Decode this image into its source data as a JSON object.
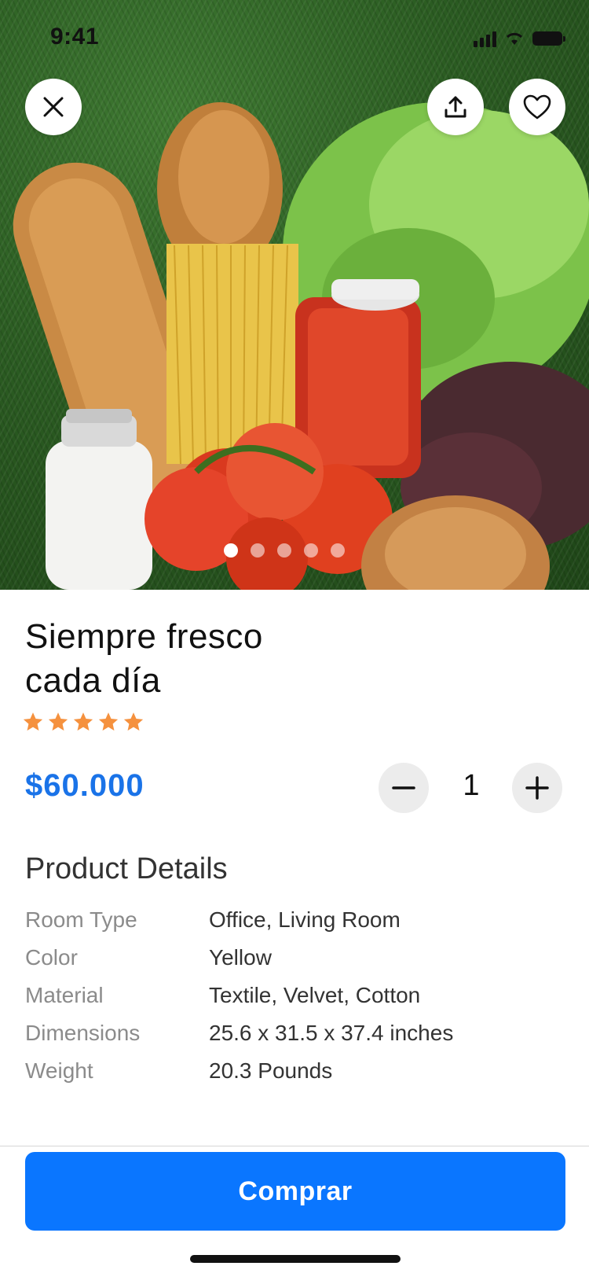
{
  "status_bar": {
    "time": "9:41"
  },
  "hero": {
    "image_icon": "grocery-photo",
    "carousel": {
      "count": 5,
      "active_index": 0
    }
  },
  "product": {
    "title_line1": "Siempre fresco",
    "title_line2": "cada día",
    "rating": 5,
    "rating_max": 5,
    "price": "$60.000",
    "quantity": "1"
  },
  "details": {
    "heading": "Product Details",
    "rows": [
      {
        "label": "Room Type",
        "value": "Office, Living Room"
      },
      {
        "label": "Color",
        "value": "Yellow"
      },
      {
        "label": "Material",
        "value": "Textile, Velvet, Cotton"
      },
      {
        "label": "Dimensions",
        "value": "25.6 x 31.5 x 37.4 inches"
      },
      {
        "label": "Weight",
        "value": "20.3 Pounds"
      }
    ]
  },
  "actions": {
    "buy_label": "Comprar"
  },
  "icons": {
    "close": "close-icon",
    "share": "share-icon",
    "favorite": "heart-icon",
    "minus": "minus-icon",
    "plus": "plus-icon",
    "star": "star-icon"
  },
  "colors": {
    "accent": "#0a76ff",
    "price": "#1a73e8",
    "star": "#f5913e"
  }
}
